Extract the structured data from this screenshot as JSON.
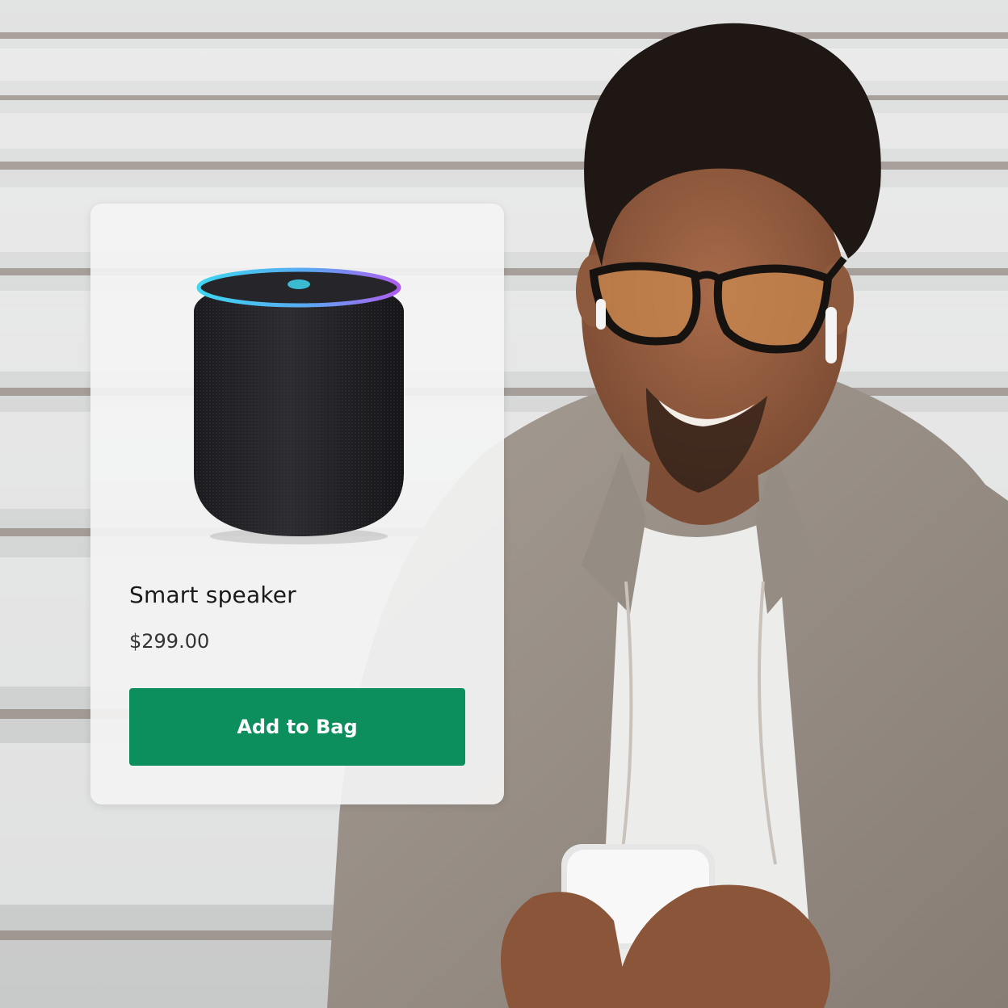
{
  "product": {
    "title": "Smart speaker",
    "price": "$299.00",
    "add_button_label": "Add to Bag",
    "image_icon": "smart-speaker-image"
  },
  "colors": {
    "button_bg": "#0c8f5c",
    "button_text": "#ffffff",
    "ring_cyan": "#3fd6f0",
    "ring_purple": "#b05cf0"
  }
}
